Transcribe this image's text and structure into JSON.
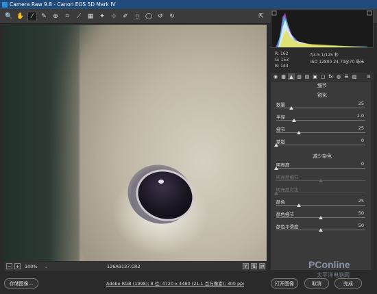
{
  "window": {
    "title": "Camera Raw 9.8 -  Canon EOS 5D Mark IV"
  },
  "toolbar": {
    "tools": [
      {
        "name": "zoom-tool",
        "glyph": "🔍"
      },
      {
        "name": "hand-tool",
        "glyph": "✋"
      },
      {
        "name": "white-balance-tool",
        "glyph": "⁄"
      },
      {
        "name": "color-sampler-tool",
        "glyph": "✎"
      },
      {
        "name": "target-adjustment-tool",
        "glyph": "⊕"
      },
      {
        "name": "crop-tool",
        "glyph": "⌗"
      },
      {
        "name": "straighten-tool",
        "glyph": "⟋"
      },
      {
        "name": "transform-tool",
        "glyph": "▦"
      },
      {
        "name": "spot-removal-tool",
        "glyph": "✦"
      },
      {
        "name": "red-eye-tool",
        "glyph": "⊹"
      },
      {
        "name": "adjustment-brush-tool",
        "glyph": "✐"
      },
      {
        "name": "graduated-filter-tool",
        "glyph": "▯"
      },
      {
        "name": "radial-filter-tool",
        "glyph": "◯"
      },
      {
        "name": "rotate-left-tool",
        "glyph": "↺"
      },
      {
        "name": "rotate-right-tool",
        "glyph": "↻"
      }
    ]
  },
  "readout": {
    "r_label": "R:",
    "r": "162",
    "g_label": "G:",
    "g": "153",
    "b_label": "B:",
    "b": "143",
    "exif_line1": "f/4.5   1/125 秒",
    "exif_line2": "ISO 12800   24-70@70 毫米"
  },
  "panel": {
    "title": "细节",
    "sharpening_title": "锐化",
    "sharpening": [
      {
        "label": "数量",
        "value": "25",
        "pos": 0.17
      },
      {
        "label": "半径",
        "value": "1.0",
        "pos": 0.2
      },
      {
        "label": "细节",
        "value": "25",
        "pos": 0.25
      },
      {
        "label": "蒙版",
        "value": "0",
        "pos": 0.0
      }
    ],
    "noise_title": "减少杂色",
    "noise": [
      {
        "label": "明亮度",
        "value": "0",
        "pos": 0.0,
        "disabled": false
      },
      {
        "label": "明亮度细节",
        "value": "",
        "pos": 0.5,
        "disabled": true
      },
      {
        "label": "明亮度对比",
        "value": "",
        "pos": 0.0,
        "disabled": true
      },
      {
        "label": "颜色",
        "value": "25",
        "pos": 0.25,
        "disabled": false
      },
      {
        "label": "颜色细节",
        "value": "50",
        "pos": 0.5,
        "disabled": false
      },
      {
        "label": "颜色平滑度",
        "value": "50",
        "pos": 0.5,
        "disabled": false
      }
    ]
  },
  "status": {
    "zoom": "100%",
    "filename": "126A9137.CR2"
  },
  "bottom": {
    "save_label": "存储图像...",
    "workflow": "Adobe RGB (1998); 8 位; 4720 x 4480 (21.1 百万像素); 300 ppi",
    "open_label": "打开图像",
    "cancel_label": "取消",
    "done_label": "完成"
  },
  "watermark": {
    "text": "PConline",
    "sub": "太平洋电脑网"
  }
}
